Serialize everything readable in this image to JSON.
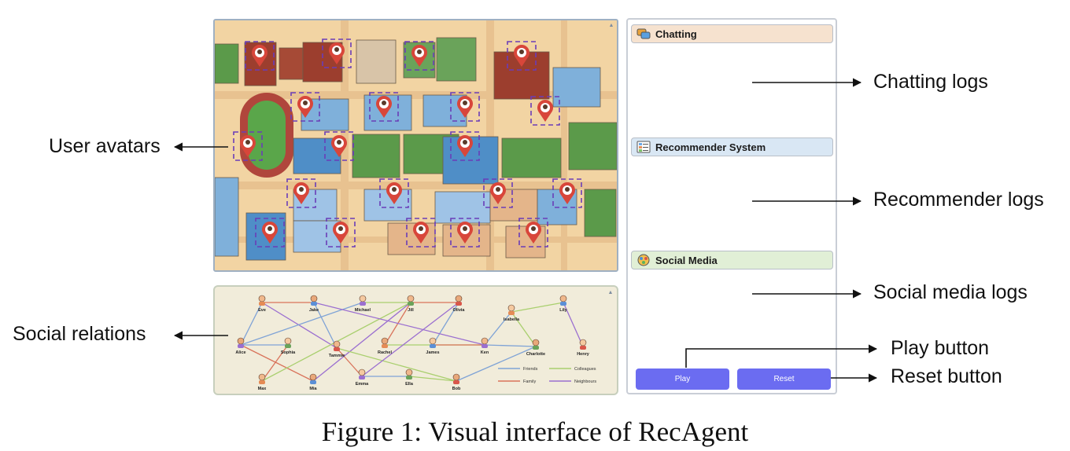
{
  "figure": {
    "caption": "Figure 1: Visual interface of RecAgent"
  },
  "annotations": {
    "user_avatars": "User avatars",
    "social_relations": "Social relations",
    "chatting_logs": "Chatting logs",
    "recommender_logs": "Recommender logs",
    "social_media_logs": "Social media logs",
    "play_button": "Play button",
    "reset_button": "Reset button"
  },
  "logs_panel": {
    "chatting": {
      "title": "Chatting",
      "color": "#f6e2cf"
    },
    "recommender": {
      "title": "Recommender System",
      "color": "#d9e7f4"
    },
    "social_media": {
      "title": "Social Media",
      "color": "#e1efd6"
    }
  },
  "controls": {
    "play_label": "Play",
    "reset_label": "Reset",
    "button_color": "#6b6cf1"
  },
  "social_graph": {
    "people": [
      "Eve",
      "Jake",
      "Michael",
      "Jill",
      "Olivia",
      "Isabella",
      "Lily",
      "Alice",
      "Sophia",
      "Tammie",
      "Rachel",
      "James",
      "Ken",
      "Charlotte",
      "Henry",
      "Max",
      "Mia",
      "Emma",
      "Ella",
      "Bob"
    ],
    "legend": [
      {
        "label": "Friends",
        "color": "#7fa3d6"
      },
      {
        "label": "Colleagues",
        "color": "#a9cf6e"
      },
      {
        "label": "Family",
        "color": "#d9735b"
      },
      {
        "label": "Neighbours",
        "color": "#9b6fd0"
      }
    ],
    "relations": [
      [
        "Eve",
        "Jake",
        "Family"
      ],
      [
        "Michael",
        "Jill",
        "Colleagues"
      ],
      [
        "Jill",
        "Olivia",
        "Family"
      ],
      [
        "Isabella",
        "Lily",
        "Colleagues"
      ],
      [
        "Eve",
        "Alice",
        "Friends"
      ],
      [
        "Eve",
        "Tammie",
        "Neighbours"
      ],
      [
        "Jake",
        "Tammie",
        "Friends"
      ],
      [
        "Michael",
        "Alice",
        "Friends"
      ],
      [
        "Jill",
        "Rachel",
        "Family"
      ],
      [
        "Olivia",
        "James",
        "Friends"
      ],
      [
        "Isabella",
        "Ken",
        "Friends"
      ],
      [
        "Lily",
        "Henry",
        "Neighbours"
      ],
      [
        "Isabella",
        "Charlotte",
        "Colleagues"
      ],
      [
        "Alice",
        "Sophia",
        "Friends"
      ],
      [
        "Sophia",
        "Max",
        "Family"
      ],
      [
        "Tammie",
        "Emma",
        "Family"
      ],
      [
        "Rachel",
        "Ken",
        "Colleagues"
      ],
      [
        "James",
        "Ken",
        "Family"
      ],
      [
        "Ken",
        "Charlotte",
        "Friends"
      ],
      [
        "Charlotte",
        "Bob",
        "Friends"
      ],
      [
        "Alice",
        "Mia",
        "Family"
      ],
      [
        "Max",
        "Jill",
        "Colleagues"
      ],
      [
        "Emma",
        "Ella",
        "Friends"
      ],
      [
        "Ella",
        "Bob",
        "Colleagues"
      ],
      [
        "Mia",
        "Jill",
        "Neighbours"
      ],
      [
        "Bob",
        "Tammie",
        "Colleagues"
      ],
      [
        "Jake",
        "Ken",
        "Neighbours"
      ],
      [
        "Emma",
        "Olivia",
        "Neighbours"
      ]
    ]
  }
}
